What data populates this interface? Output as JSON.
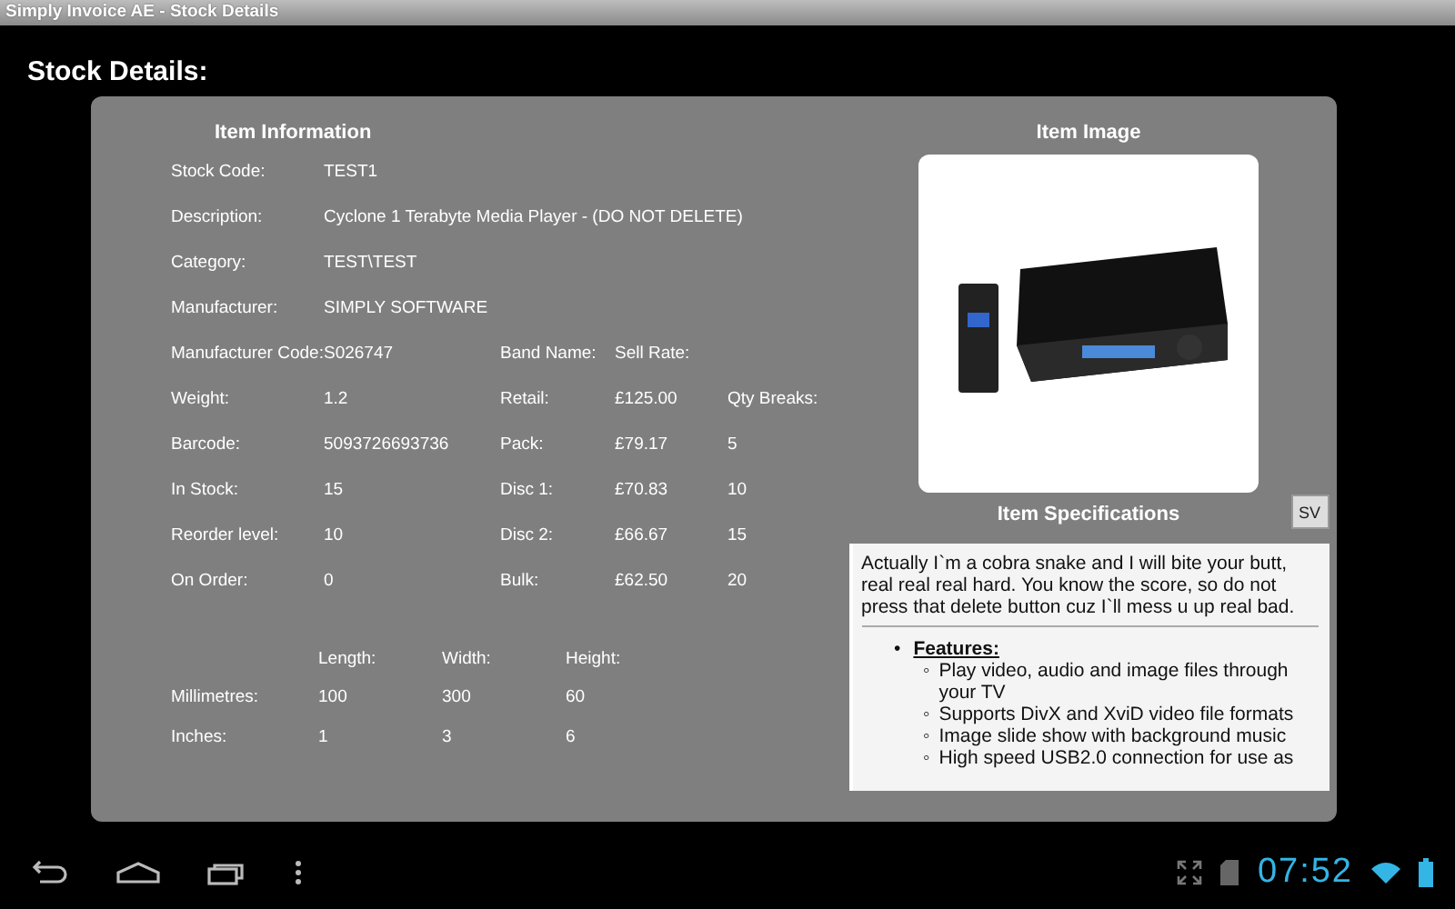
{
  "window": {
    "title": "Simply Invoice AE - Stock Details"
  },
  "page_title": "Stock Details:",
  "item_information": {
    "heading": "Item Information",
    "rows": [
      {
        "label": "Stock Code:",
        "value": "TEST1"
      },
      {
        "label": "Description:",
        "value": "Cyclone 1 Terabyte Media Player - (DO NOT DELETE)"
      },
      {
        "label": "Category:",
        "value": "TEST\\TEST"
      },
      {
        "label": "Manufacturer:",
        "value": "SIMPLY SOFTWARE"
      },
      {
        "label": "Manufacturer Code:",
        "value": "S026747",
        "price_label": "Band Name:",
        "price": "Sell Rate:"
      },
      {
        "label": "Weight:",
        "value": "1.2",
        "price_label": "Retail:",
        "price": "£125.00",
        "qty": "Qty Breaks:"
      },
      {
        "label": "Barcode:",
        "value": "5093726693736",
        "price_label": "Pack:",
        "price": "£79.17",
        "qty": "5"
      },
      {
        "label": "In Stock:",
        "value": "15",
        "price_label": "Disc 1:",
        "price": "£70.83",
        "qty": "10"
      },
      {
        "label": "Reorder level:",
        "value": "10",
        "price_label": "Disc 2:",
        "price": "£66.67",
        "qty": "15"
      },
      {
        "label": "On Order:",
        "value": "0",
        "price_label": "Bulk:",
        "price": "£62.50",
        "qty": "20"
      }
    ],
    "dimensions": {
      "headers": [
        "Length:",
        "Width:",
        "Height:"
      ],
      "rows": [
        {
          "label": "Millimetres:",
          "values": [
            "100",
            "300",
            "60"
          ]
        },
        {
          "label": "Inches:",
          "values": [
            "1",
            "3",
            "6"
          ]
        }
      ]
    }
  },
  "item_image": {
    "heading": "Item Image"
  },
  "item_specifications": {
    "heading": "Item Specifications",
    "button": "SV",
    "intro": "Actually I`m a cobra snake and I will bite your butt, real real real hard. You know the score, so do not press that delete button cuz I`ll mess u up real bad.",
    "features_marker": "•",
    "features_heading": "Features:",
    "features": [
      {
        "marker": "◦",
        "text": "Play video, audio and image files through your TV"
      },
      {
        "marker": "◦",
        "text": "Supports DivX and XviD video file formats"
      },
      {
        "marker": "◦",
        "text": "Image slide show with background music"
      },
      {
        "marker": "◦",
        "text": "High speed USB2.0 connection for use as"
      }
    ]
  },
  "status_bar": {
    "time": "07:52"
  }
}
